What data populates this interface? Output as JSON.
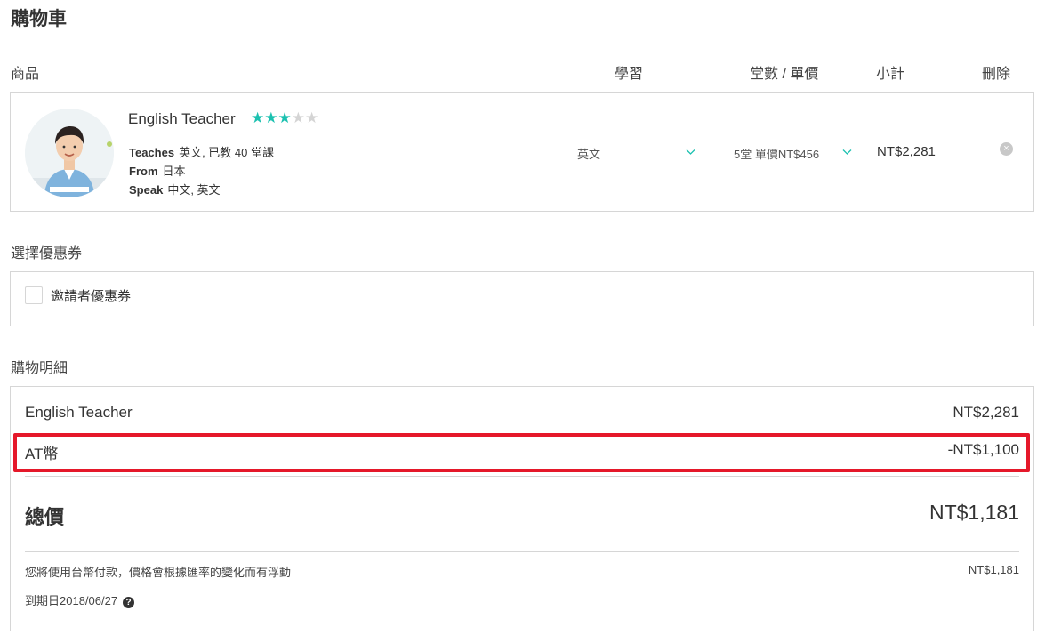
{
  "page": {
    "title": "購物車"
  },
  "columns": {
    "product": "商品",
    "learn": "學習",
    "lessons": "堂數 / 單價",
    "subtotal": "小計",
    "delete": "刪除"
  },
  "cart_item": {
    "name": "English Teacher",
    "rating": 3,
    "rating_max": 5,
    "teaches_label": "Teaches",
    "teaches_value": "英文, 已教 40 堂課",
    "from_label": "From",
    "from_value": "日本",
    "speak_label": "Speak",
    "speak_value": "中文, 英文",
    "learn_selected": "英文",
    "lessons_selected": "5堂 單價NT$456",
    "subtotal": "NT$2,281"
  },
  "coupon": {
    "section_title": "選擇優惠券",
    "option_label": "邀請者優惠券",
    "checked": false
  },
  "summary": {
    "section_title": "購物明細",
    "lines": [
      {
        "name": "English Teacher",
        "value": "NT$2,281"
      },
      {
        "name": "AT幣",
        "value": "-NT$1,100"
      }
    ],
    "total_label": "總價",
    "total_value": "NT$1,181",
    "note": "您將使用台幣付款，價格會根據匯率的變化而有浮動",
    "note_value": "NT$1,181",
    "expiry": "到期日2018/06/27"
  },
  "colors": {
    "accent": "#1cc1b0",
    "highlight": "#e5182a",
    "border": "#d6d6d6"
  },
  "icons": {
    "chevron": "chevron-down-icon",
    "remove": "close-circle-icon",
    "help": "question-circle-icon"
  }
}
